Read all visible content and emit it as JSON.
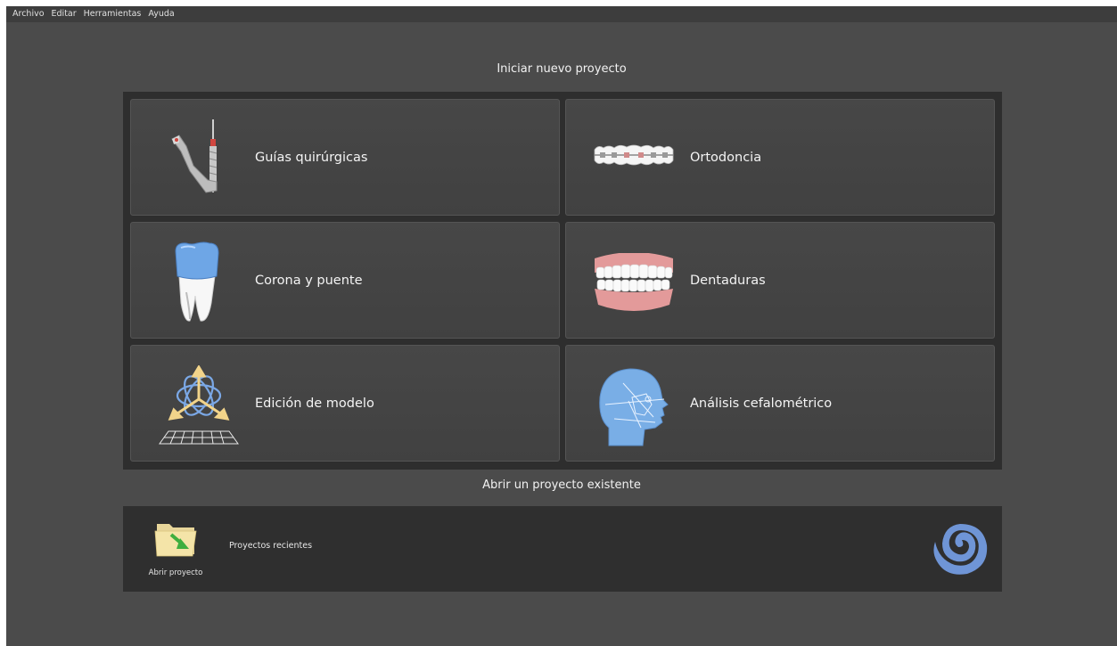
{
  "menu": [
    "Archivo",
    "Editar",
    "Herramientas",
    "Ayuda"
  ],
  "new_project": {
    "title": "Iniciar nuevo proyecto",
    "tiles": [
      {
        "label": "Guías quirúrgicas",
        "icon": "surgical-guide-icon"
      },
      {
        "label": "Ortodoncia",
        "icon": "braces-icon"
      },
      {
        "label": "Corona y puente",
        "icon": "tooth-crown-icon"
      },
      {
        "label": "Dentaduras",
        "icon": "dentures-icon"
      },
      {
        "label": "Edición de modelo",
        "icon": "model-edit-gizmo-icon"
      },
      {
        "label": "Análisis cefalométrico",
        "icon": "cephalometric-head-icon"
      }
    ]
  },
  "open_existing": {
    "title": "Abrir un proyecto existente",
    "open_label": "Abrir proyecto",
    "recent_label": "Proyectos recientes",
    "logo": "swirl-logo"
  },
  "colors": {
    "background": "#4b4b4b",
    "panel": "#2e2e2e",
    "tile": "#444444",
    "accent_blue": "#6f95d6"
  }
}
